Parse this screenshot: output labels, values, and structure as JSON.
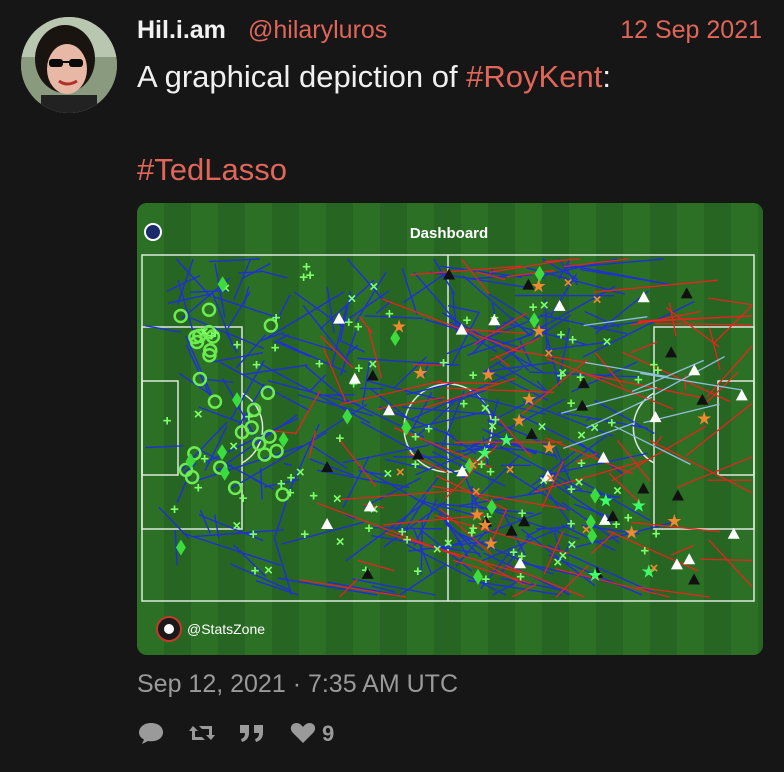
{
  "tweet": {
    "display_name": "Hil.i.am",
    "handle": "@hilaryluros",
    "date": "12 Sep 2021",
    "text_prefix": "A graphical depiction of ",
    "hashtag1": "#RoyKent",
    "text_suffix": ":",
    "hashtag2": "#TedLasso",
    "timestamp": "Sep 12, 2021 · 7:35 AM UTC"
  },
  "media": {
    "title": "Dashboard",
    "watermark": "@StatsZone",
    "pitch_color": "#2c7026",
    "line_color": "#ffffff",
    "pass_color": "#1f2fd8",
    "red_color": "#e5251e"
  },
  "actions": {
    "reply_icon": "comment-icon",
    "retweet_icon": "retweet-icon",
    "quote_icon": "quote-icon",
    "like_icon": "heart-icon",
    "like_count": "9"
  }
}
